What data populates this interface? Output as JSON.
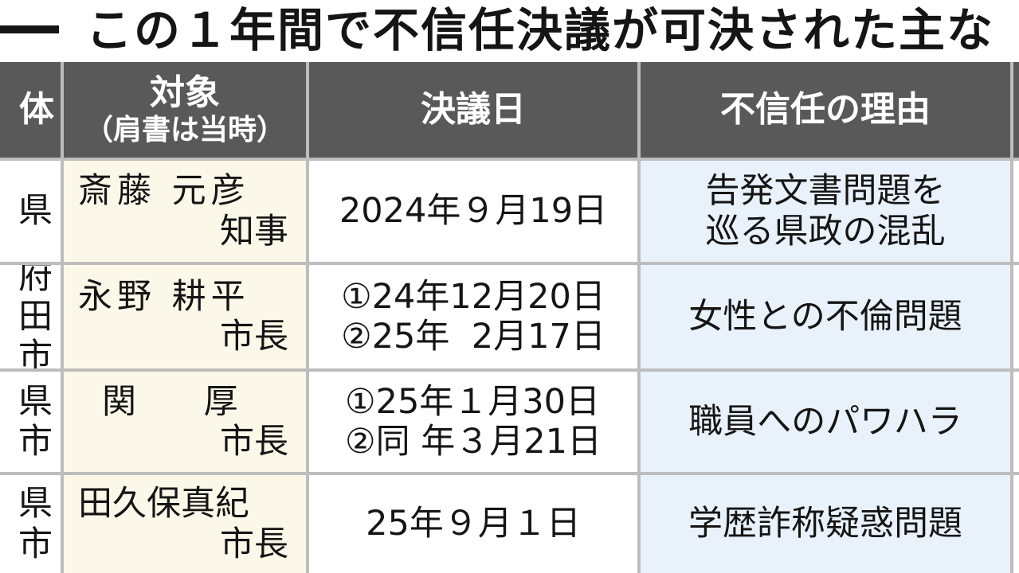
{
  "title": {
    "text": "この１年間で不信任決議が可決された主な"
  },
  "table": {
    "headers": {
      "municipality": "体",
      "target_line1": "対象",
      "target_line2": "（肩書は当時）",
      "date": "決議日",
      "reason": "不信任の理由"
    },
    "rows": [
      {
        "municipality": [
          "県"
        ],
        "name": "斎藤 元彦",
        "position": "知事",
        "dates": [
          "2024年９月19日"
        ],
        "reason": [
          "告発文書問題を",
          "巡る県政の混乱"
        ]
      },
      {
        "municipality": [
          "府",
          "田市"
        ],
        "name": "永野 耕平",
        "position": "市長",
        "dates": [
          "①24年12月20日",
          "②25年  2月17日"
        ],
        "reason": [
          "女性との不倫問題"
        ]
      },
      {
        "municipality": [
          "県",
          "市"
        ],
        "name": "関    厚",
        "position": "市長",
        "dates": [
          "①25年１月30日",
          "②同 年３月21日"
        ],
        "reason": [
          "職員へのパワハラ"
        ]
      },
      {
        "municipality": [
          "県",
          "市"
        ],
        "name": "田久保真紀",
        "position": "市長",
        "dates": [
          "25年９月１日"
        ],
        "reason": [
          "学歴詐称疑惑問題"
        ]
      }
    ]
  }
}
